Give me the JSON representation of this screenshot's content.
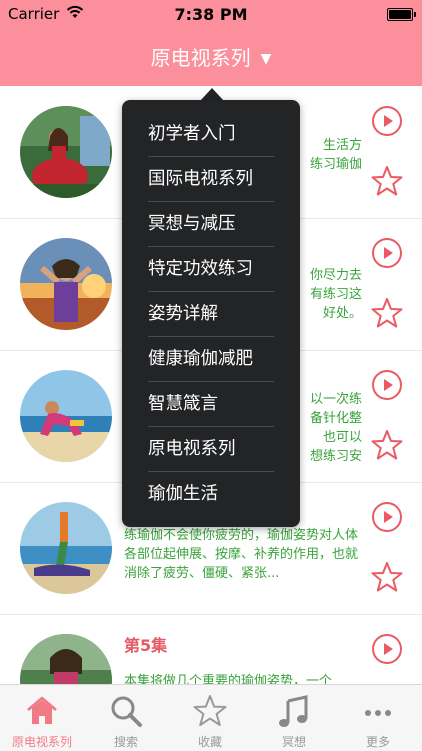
{
  "status_bar": {
    "carrier": "Carrier",
    "time": "7:38 PM"
  },
  "nav": {
    "title": "原电视系列",
    "caret": "▼"
  },
  "rows": [
    {
      "title": "",
      "description": "生活方\n练习瑜伽"
    },
    {
      "title": "",
      "description": "你尽力去\n有练习这\n好处。"
    },
    {
      "title": "",
      "description": "以一次练\n备针化整\n也可以\n想练习安"
    },
    {
      "title": "",
      "description": "练瑜伽不会使你疲劳的，瑜伽姿势对人体各部位起伸展、按摩、补养的作用，也就消除了疲劳、僵硬、紧张..."
    },
    {
      "title": "第5集",
      "description": "本集将做几个重要的瑜伽姿势，一个"
    }
  ],
  "dropdown": {
    "items": [
      "初学者入门",
      "国际电视系列",
      "冥想与减压",
      "特定功效练习",
      "姿势详解",
      "健康瑜伽减肥",
      "智慧箴言",
      "原电视系列",
      "瑜伽生活"
    ]
  },
  "tabs": [
    {
      "label": "原电视系列",
      "icon": "home-icon",
      "active": true
    },
    {
      "label": "搜索",
      "icon": "search-icon",
      "active": false
    },
    {
      "label": "收藏",
      "icon": "star-icon",
      "active": false
    },
    {
      "label": "冥想",
      "icon": "music-note-icon",
      "active": false
    },
    {
      "label": "更多",
      "icon": "more-dots-icon",
      "active": false
    }
  ],
  "colors": {
    "accent": "#fb8f9c",
    "title_red": "#e45b63",
    "desc_green": "#3aa33c",
    "menu_bg": "#232426"
  }
}
